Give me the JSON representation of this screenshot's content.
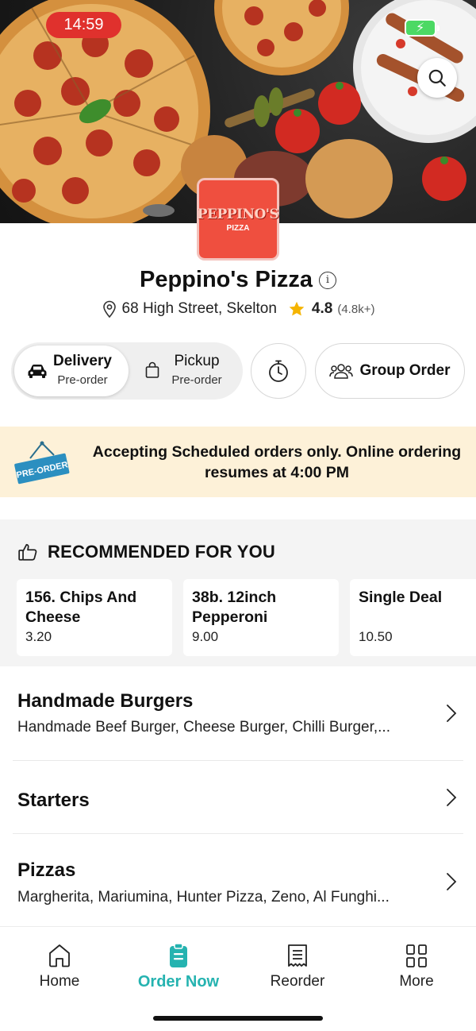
{
  "status_bar": {
    "time": "14:59"
  },
  "restaurant": {
    "logo_line1": "PEPPINO'S",
    "logo_line2": "PIZZA",
    "name": "Peppino's Pizza",
    "address": "68 High Street, Skelton",
    "rating": "4.8",
    "rating_count": "(4.8k+)"
  },
  "order_mode": {
    "delivery_label": "Delivery",
    "delivery_sub": "Pre-order",
    "pickup_label": "Pickup",
    "pickup_sub": "Pre-order",
    "selected": "delivery",
    "group_order_label": "Group Order"
  },
  "notice": {
    "sign_text": "PRE-ORDER",
    "text": "Accepting Scheduled orders only. Online ordering resumes at 4:00 PM"
  },
  "recommended": {
    "title": "RECOMMENDED FOR YOU",
    "items": [
      {
        "name": "156. Chips And Cheese",
        "price": "3.20"
      },
      {
        "name": "38b. 12inch Pepperoni",
        "price": "9.00"
      },
      {
        "name": "Single Deal",
        "price": "10.50"
      }
    ]
  },
  "categories": [
    {
      "title": "Handmade Burgers",
      "desc": "Handmade Beef Burger, Cheese Burger, Chilli Burger,..."
    },
    {
      "title": "Starters",
      "desc": ""
    },
    {
      "title": "Pizzas",
      "desc": "Margherita, Mariumina, Hunter Pizza, Zeno, Al Funghi..."
    }
  ],
  "bottom_nav": [
    {
      "label": "Home",
      "icon": "home-icon"
    },
    {
      "label": "Order Now",
      "icon": "order-icon",
      "active": true
    },
    {
      "label": "Reorder",
      "icon": "receipt-icon"
    },
    {
      "label": "More",
      "icon": "grid-icon"
    }
  ],
  "colors": {
    "accent": "#25b3b0",
    "notice_bg": "#fdf1d8",
    "logo_red": "#ef4f3f",
    "status_red": "#e0312d"
  }
}
